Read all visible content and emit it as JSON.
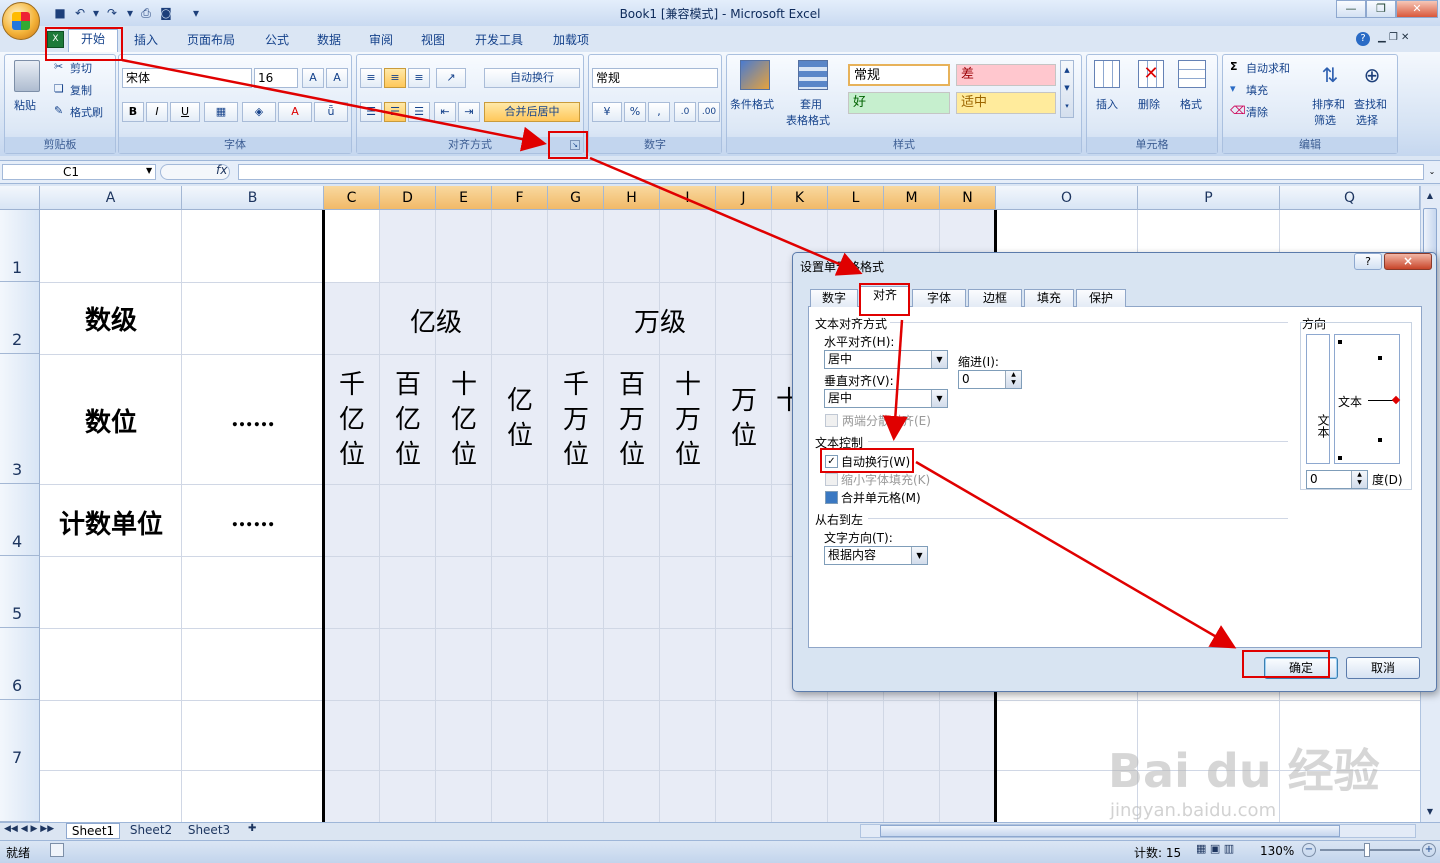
{
  "window": {
    "title": "Book1  [兼容模式] - Microsoft Excel"
  },
  "tabs": [
    "开始",
    "插入",
    "页面布局",
    "公式",
    "数据",
    "审阅",
    "视图",
    "开发工具",
    "加载项"
  ],
  "ribbon": {
    "clipboard": {
      "paste": "粘贴",
      "cut": "剪切",
      "copy": "复制",
      "format_painter": "格式刷",
      "label": "剪贴板"
    },
    "font": {
      "name": "宋体",
      "size": "16",
      "bold": "B",
      "italic": "I",
      "underline": "U",
      "label": "字体"
    },
    "alignment": {
      "wrap": "自动换行",
      "merge": "合并后居中",
      "label": "对齐方式"
    },
    "number": {
      "format": "常规",
      "percent": "%",
      "comma": ",",
      "label": "数字"
    },
    "styles": {
      "cond": "条件格式",
      "table": "套用",
      "table2": "表格格式",
      "normal": "常规",
      "bad": "差",
      "good": "好",
      "neutral": "适中",
      "label": "样式"
    },
    "cells": {
      "insert": "插入",
      "delete": "删除",
      "format": "格式",
      "label": "单元格"
    },
    "editing": {
      "autosum": "自动求和",
      "fill": "填充",
      "clear": "清除",
      "sort": "排序和",
      "sort2": "筛选",
      "find": "查找和",
      "find2": "选择",
      "label": "编辑"
    }
  },
  "formula_bar": {
    "name_box": "C1",
    "fx": "fx"
  },
  "columns": [
    "A",
    "B",
    "C",
    "D",
    "E",
    "F",
    "G",
    "H",
    "I",
    "J",
    "K",
    "L",
    "M",
    "N",
    "O",
    "P",
    "Q"
  ],
  "rows": [
    "1",
    "2",
    "3",
    "4",
    "5",
    "6",
    "7"
  ],
  "cells": {
    "a2": "数级",
    "a3": "数位",
    "a4": "计数单位",
    "b3": "……",
    "b4": "……",
    "yi_level": "亿级",
    "wan_level": "万级",
    "qianyi": [
      "千",
      "亿",
      "位"
    ],
    "baiyi": [
      "百",
      "亿",
      "位"
    ],
    "shiyi": [
      "十",
      "亿",
      "位"
    ],
    "yi": [
      "亿",
      "位"
    ],
    "qianwan": [
      "千",
      "万",
      "位"
    ],
    "baiwan": [
      "百",
      "万",
      "位"
    ],
    "shiwan": [
      "十",
      "万",
      "位"
    ],
    "wan": [
      "万",
      "位"
    ],
    "partial": "十"
  },
  "sheets": [
    "Sheet1",
    "Sheet2",
    "Sheet3"
  ],
  "status": {
    "ready": "就绪",
    "count": "计数: 15",
    "zoom": "130%"
  },
  "dialog": {
    "title": "设置单元格格式",
    "help": "?",
    "close": "×",
    "tabs": [
      "数字",
      "对齐",
      "字体",
      "边框",
      "填充",
      "保护"
    ],
    "text_align_section": "文本对齐方式",
    "horizontal_label": "水平对齐(H):",
    "horizontal_value": "居中",
    "indent_label": "缩进(I):",
    "indent_value": "0",
    "vertical_label": "垂直对齐(V):",
    "vertical_value": "居中",
    "justify_distributed": "两端分散对齐(E)",
    "text_control_section": "文本控制",
    "wrap_text": "自动换行(W)",
    "shrink_to_fit": "缩小字体填充(K)",
    "merge_cells": "合并单元格(M)",
    "rtl_section": "从右到左",
    "text_direction_label": "文字方向(T):",
    "text_direction_value": "根据内容",
    "orientation_label": "方向",
    "orientation_vertical_text": "文本",
    "orientation_text": "文本",
    "degree_value": "0",
    "degree_label": "度(D)",
    "ok": "确定",
    "cancel": "取消",
    "checked": "✓"
  },
  "watermark": {
    "brand": "Bai du 经验",
    "url": "jingyan.baidu.com"
  },
  "colors": {
    "accent": "#e00000",
    "selection": "#e8ecf6",
    "ribbon": "#dbe6f4"
  }
}
